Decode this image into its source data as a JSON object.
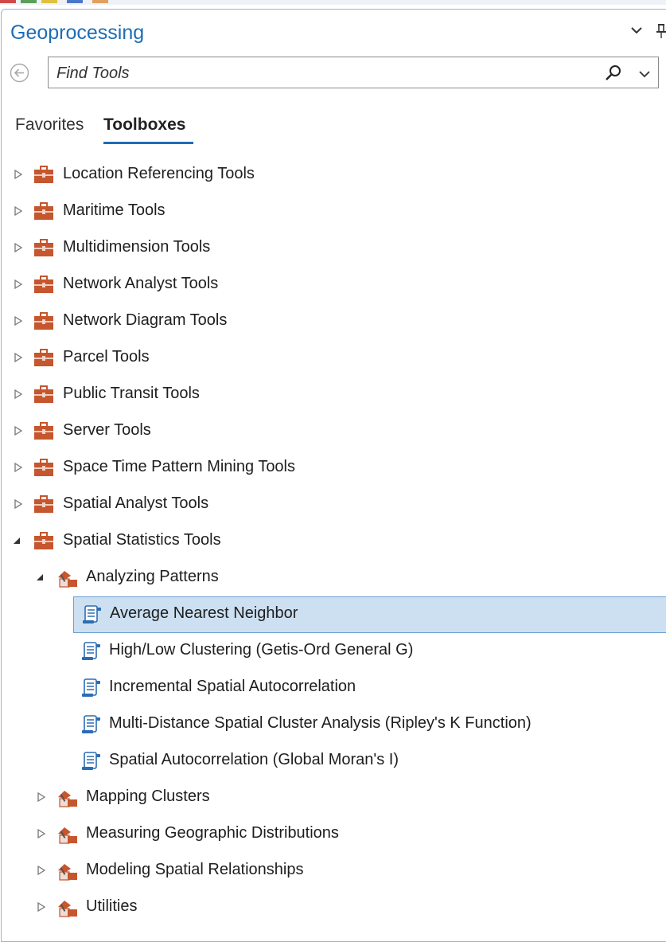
{
  "panel": {
    "title": "Geoprocessing"
  },
  "search": {
    "placeholder": "Find Tools"
  },
  "tabs": {
    "favorites": "Favorites",
    "toolboxes": "Toolboxes"
  },
  "tree": {
    "toolboxes": [
      {
        "label": "Location Referencing Tools",
        "expanded": false
      },
      {
        "label": "Maritime Tools",
        "expanded": false
      },
      {
        "label": "Multidimension Tools",
        "expanded": false
      },
      {
        "label": "Network Analyst Tools",
        "expanded": false
      },
      {
        "label": "Network Diagram Tools",
        "expanded": false
      },
      {
        "label": "Parcel Tools",
        "expanded": false
      },
      {
        "label": "Public Transit Tools",
        "expanded": false
      },
      {
        "label": "Server Tools",
        "expanded": false
      },
      {
        "label": "Space Time Pattern Mining Tools",
        "expanded": false
      },
      {
        "label": "Spatial Analyst Tools",
        "expanded": false
      },
      {
        "label": "Spatial Statistics Tools",
        "expanded": true
      }
    ],
    "toolsets": [
      {
        "label": "Analyzing Patterns",
        "expanded": true
      },
      {
        "label": "Mapping Clusters",
        "expanded": false
      },
      {
        "label": "Measuring Geographic Distributions",
        "expanded": false
      },
      {
        "label": "Modeling Spatial Relationships",
        "expanded": false
      },
      {
        "label": "Utilities",
        "expanded": false
      }
    ],
    "tools": [
      {
        "label": "Average Nearest Neighbor",
        "selected": true
      },
      {
        "label": "High/Low Clustering (Getis-Ord General G)",
        "selected": false
      },
      {
        "label": "Incremental Spatial Autocorrelation",
        "selected": false
      },
      {
        "label": "Multi-Distance Spatial Cluster Analysis (Ripley's K Function)",
        "selected": false
      },
      {
        "label": "Spatial Autocorrelation (Global Moran's I)",
        "selected": false
      }
    ]
  },
  "icons": {
    "toolbox": "toolbox-icon",
    "toolset": "toolset-icon",
    "tool": "script-tool-icon"
  },
  "colors": {
    "accent": "#1c6db5",
    "toolbox": "#c5562d",
    "selection": "#cce0f2"
  }
}
